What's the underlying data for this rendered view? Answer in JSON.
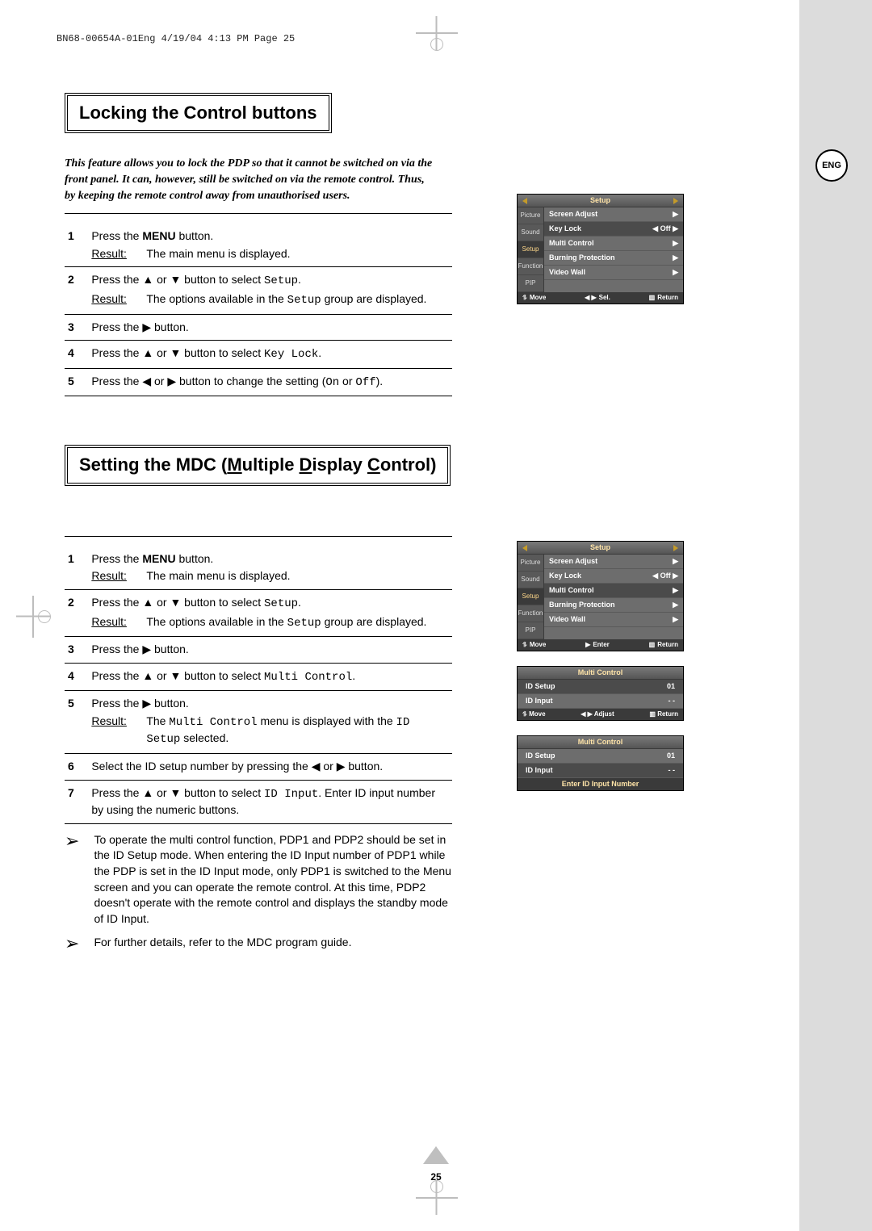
{
  "header_line": "BN68-00654A-01Eng  4/19/04  4:13 PM  Page 25",
  "lang_badge": "ENG",
  "page_number": "25",
  "section1": {
    "title": "Locking the Control buttons",
    "intro": "This feature allows you to lock the PDP so that it cannot be switched on via the front panel. It can, however, still be switched on via the remote control. Thus, by keeping the remote control away from unauthorised users.",
    "steps": [
      {
        "num": "1",
        "text_pre": "Press the ",
        "bold": "MENU",
        "text_post": " button.",
        "result": "The main menu is displayed.",
        "border": true
      },
      {
        "num": "2",
        "text": "Press the ▲ or ▼ button to select ",
        "code": "Setup",
        "text2": ".",
        "result_pre": "The options available in the ",
        "result_code": "Setup",
        "result_post": " group are displayed.",
        "border": true
      },
      {
        "num": "3",
        "text": "Press the ▶ button.",
        "border": true
      },
      {
        "num": "4",
        "text": "Press the ▲ or ▼ button to select ",
        "code": "Key Lock",
        "text2": ".",
        "border": true
      },
      {
        "num": "5",
        "text": "Press the ◀ or ▶ button to change the setting (",
        "code": "On",
        "mid": " or ",
        "code2": "Off",
        "text2": ").",
        "border": true
      }
    ]
  },
  "section2": {
    "title_pre": "Setting the MDC (",
    "title_u1": "M",
    "title_m1": "ultiple ",
    "title_u2": "D",
    "title_m2": "isplay ",
    "title_u3": "C",
    "title_m3": "ontrol)",
    "steps": [
      {
        "num": "1",
        "text_pre": "Press the ",
        "bold": "MENU",
        "text_post": " button.",
        "result": "The main menu is displayed.",
        "border": true
      },
      {
        "num": "2",
        "text": "Press the ▲ or ▼ button to select ",
        "code": "Setup",
        "text2": ".",
        "result_pre": "The options available in the ",
        "result_code": "Setup",
        "result_post": " group are displayed.",
        "border": true
      },
      {
        "num": "3",
        "text": "Press the ▶ button.",
        "border": true
      },
      {
        "num": "4",
        "text": "Press the ▲ or ▼ button to select ",
        "code": "Multi Control",
        "text2": ".",
        "border": true
      },
      {
        "num": "5",
        "text": "Press the ▶ button.",
        "result_pre": "The ",
        "result_code": "Multi Control",
        "result_mid": " menu is displayed with the ",
        "result_code2": "ID Setup",
        "result_post": " selected.",
        "border": true
      },
      {
        "num": "6",
        "text": "Select the ID setup number by pressing the ◀ or ▶ button.",
        "border": true
      },
      {
        "num": "7",
        "text": "Press the ▲ or ▼ button to select ",
        "code": "ID Input",
        "text2": ". Enter ID input number by using the numeric buttons.",
        "border": true
      }
    ],
    "notes": [
      "To operate the multi control function, PDP1 and PDP2 should be set in the ID Setup mode. When entering the ID Input number of PDP1 while the PDP is set in the ID Input mode, only PDP1 is switched to the Menu screen and you can operate the remote control. At this time, PDP2 doesn't operate with the remote control and displays the standby mode of ID Input.",
      "For further details, refer to the MDC program guide."
    ]
  },
  "labels": {
    "result": "Result:"
  },
  "osd": {
    "setup_title": "Setup",
    "tabs": [
      "Picture",
      "Sound",
      "Setup",
      "Function",
      "PIP"
    ],
    "rows": [
      {
        "label": "Screen Adjust",
        "val": "▶"
      },
      {
        "label": "Key Lock",
        "val": "◀  Off  ▶",
        "hl": true
      },
      {
        "label": "Multi Control",
        "val": "▶"
      },
      {
        "label": "Burning Protection",
        "val": "▶"
      },
      {
        "label": "Video Wall",
        "val": "▶"
      }
    ],
    "foot1": {
      "move": "Move",
      "sel": "Sel.",
      "ret": "Return",
      "sel_glyph": "◀ ▶",
      "move_glyph": "⥮",
      "ret_glyph": "▥"
    },
    "rows2_hl_idx": 2,
    "foot2": {
      "move": "Move",
      "enter": "Enter",
      "ret": "Return",
      "enter_glyph": "▶",
      "move_glyph": "⥮",
      "ret_glyph": "▥"
    },
    "multi_title": "Multi Control",
    "multi_rows": [
      {
        "label": "ID Setup",
        "val": "01",
        "hl": true
      },
      {
        "label": "ID Input",
        "val": "- -"
      }
    ],
    "multi_foot": {
      "move": "Move",
      "adj": "Adjust",
      "ret": "Return",
      "adj_glyph": "◀ ▶",
      "move_glyph": "⥮",
      "ret_glyph": "▥"
    },
    "multi2_rows": [
      {
        "label": "ID Setup",
        "val": "01"
      },
      {
        "label": "ID Input",
        "val": "- -",
        "hl": true
      }
    ],
    "multi2_bar": "Enter ID Input Number"
  }
}
